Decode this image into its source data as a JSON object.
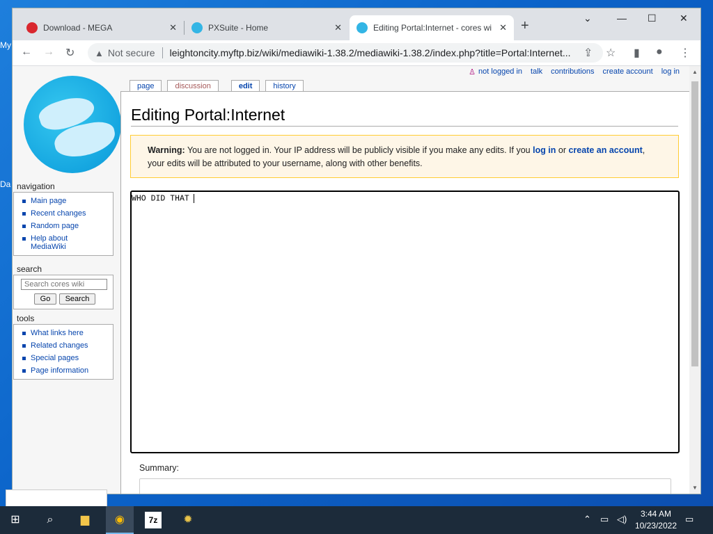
{
  "desktop": {
    "label1": "My",
    "label2": "Da"
  },
  "browser": {
    "tabs": [
      {
        "title": "Download - MEGA",
        "fav_color": "#d9272e"
      },
      {
        "title": "PXSuite - Home",
        "fav_color": "#33b5e5"
      },
      {
        "title": "Editing Portal:Internet - cores wi",
        "fav_color": "#33b5e5"
      }
    ],
    "security_label": "Not secure",
    "url": "leightoncity.myftp.biz/wiki/mediawiki-1.38.2/mediawiki-1.38.2/index.php?title=Portal:Internet..."
  },
  "wiki": {
    "personal": [
      "not logged in",
      "talk",
      "contributions",
      "create account",
      "log in"
    ],
    "tabs": [
      "page",
      "discussion",
      "edit",
      "history"
    ],
    "heading": "Editing Portal:Internet",
    "warning": {
      "bold": "Warning:",
      "text1": " You are not logged in. Your IP address will be publicly visible if you make any edits. If you ",
      "login": "log in",
      "text2": " or ",
      "create": "create an account",
      "text3": ", your edits will be attributed to your username, along with other benefits."
    },
    "editor_text": "WHO DID THAT",
    "summary_label": "Summary:",
    "navigation": {
      "title": "navigation",
      "items": [
        "Main page",
        "Recent changes",
        "Random page",
        "Help about MediaWiki"
      ]
    },
    "search": {
      "title": "search",
      "placeholder": "Search cores wiki",
      "go": "Go",
      "search": "Search"
    },
    "tools": {
      "title": "tools",
      "items": [
        "What links here",
        "Related changes",
        "Special pages",
        "Page information"
      ]
    }
  },
  "taskbar": {
    "time": "3:44 AM",
    "date": "10/23/2022"
  }
}
